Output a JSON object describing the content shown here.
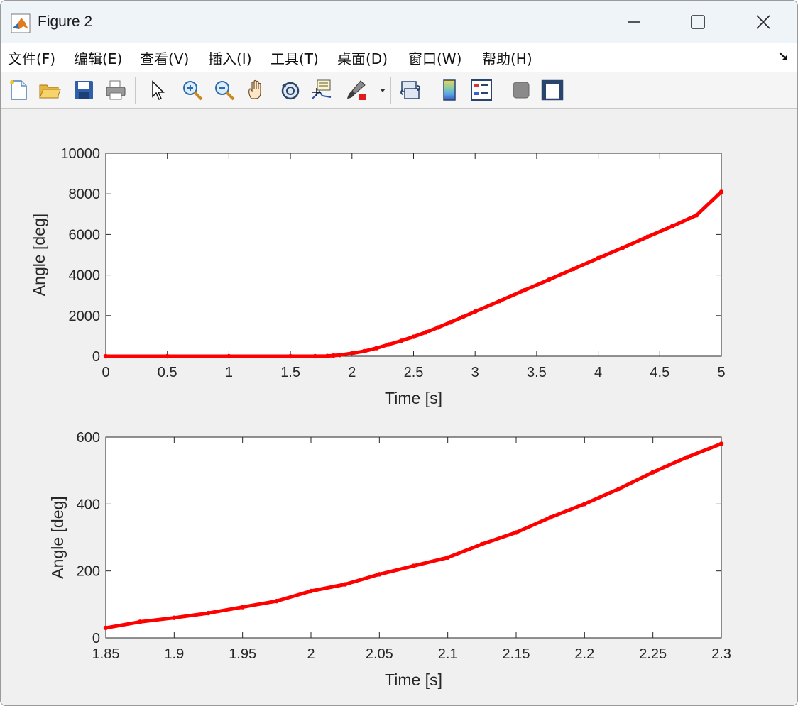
{
  "window": {
    "title": "Figure 2"
  },
  "menu": {
    "items": [
      "文件(F)",
      "编辑(E)",
      "查看(V)",
      "插入(I)",
      "工具(T)",
      "桌面(D)",
      "窗口(W)",
      "帮助(H)"
    ]
  },
  "toolbar": {
    "icons": [
      "new-figure-icon",
      "open-file-icon",
      "save-icon",
      "print-icon",
      "pointer-icon",
      "zoom-in-icon",
      "zoom-out-icon",
      "pan-hand-icon",
      "rotate-3d-icon",
      "data-cursor-icon",
      "brush-icon",
      "link-plot-icon",
      "colorbar-icon",
      "legend-icon",
      "hide-plot-tools-icon",
      "show-plot-tools-icon"
    ]
  },
  "colors": {
    "line": "#ff0000",
    "axes_bg": "#ffffff",
    "figure_bg": "#f0f0f0",
    "axis": "#262626"
  },
  "chart_data": [
    {
      "type": "line",
      "title": "",
      "xlabel": "Time [s]",
      "ylabel": "Angle [deg]",
      "xlim": [
        0,
        5
      ],
      "ylim": [
        0,
        10000
      ],
      "xticks": [
        0,
        0.5,
        1,
        1.5,
        2,
        2.5,
        3,
        3.5,
        4,
        4.5,
        5
      ],
      "xtick_labels": [
        "0",
        "0.5",
        "1",
        "1.5",
        "2",
        "2.5",
        "3",
        "3.5",
        "4",
        "4.5",
        "5"
      ],
      "yticks": [
        0,
        2000,
        4000,
        6000,
        8000,
        10000
      ],
      "ytick_labels": [
        "0",
        "2000",
        "4000",
        "6000",
        "8000",
        "10000"
      ],
      "grid": false,
      "series": [
        {
          "color": "#ff0000",
          "marker": "dot",
          "x": [
            0,
            0.5,
            1,
            1.5,
            1.7,
            1.8,
            1.85,
            1.9,
            2.0,
            2.1,
            2.2,
            2.3,
            2.4,
            2.5,
            2.6,
            2.7,
            2.8,
            2.9,
            3.0,
            3.2,
            3.4,
            3.6,
            3.8,
            4.0,
            4.2,
            4.4,
            4.6,
            4.8,
            5.0
          ],
          "y": [
            0,
            0,
            0,
            0,
            0,
            10,
            35,
            60,
            145,
            250,
            400,
            580,
            760,
            960,
            1180,
            1420,
            1670,
            1930,
            2200,
            2720,
            3250,
            3770,
            4300,
            4830,
            5350,
            5880,
            6400,
            6950,
            8100
          ]
        }
      ]
    },
    {
      "type": "line",
      "title": "",
      "xlabel": "Time [s]",
      "ylabel": "Angle [deg]",
      "xlim": [
        1.85,
        2.3
      ],
      "ylim": [
        0,
        600
      ],
      "xticks": [
        1.85,
        1.9,
        1.95,
        2,
        2.05,
        2.1,
        2.15,
        2.2,
        2.25,
        2.3
      ],
      "xtick_labels": [
        "1.85",
        "1.9",
        "1.95",
        "2",
        "2.05",
        "2.1",
        "2.15",
        "2.2",
        "2.25",
        "2.3"
      ],
      "yticks": [
        0,
        200,
        400,
        600
      ],
      "ytick_labels": [
        "0",
        "200",
        "400",
        "600"
      ],
      "grid": false,
      "series": [
        {
          "color": "#ff0000",
          "marker": "dot",
          "x": [
            1.85,
            1.875,
            1.9,
            1.925,
            1.95,
            1.975,
            2.0,
            2.025,
            2.05,
            2.075,
            2.1,
            2.125,
            2.15,
            2.175,
            2.2,
            2.225,
            2.25,
            2.275,
            2.3
          ],
          "y": [
            30,
            48,
            60,
            74,
            92,
            110,
            140,
            160,
            190,
            215,
            240,
            280,
            315,
            360,
            400,
            445,
            495,
            540,
            580
          ]
        }
      ]
    }
  ]
}
